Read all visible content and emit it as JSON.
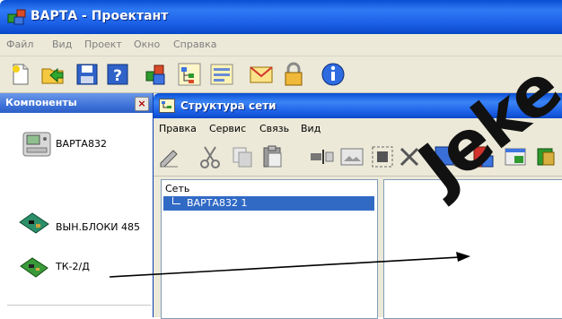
{
  "app": {
    "title": "ВАРТА - Проектант"
  },
  "menu": [
    "Файл",
    "Вид",
    "Проект",
    "Окно",
    "Справка"
  ],
  "toolbar": {
    "icons": [
      "new-icon",
      "open-icon",
      "save-icon",
      "help-icon",
      "components-icon",
      "tree-icon",
      "list-icon",
      "mail-icon",
      "lock-icon",
      "info-icon"
    ]
  },
  "components": {
    "header": "Компоненты",
    "close_glyph": "×",
    "items": [
      {
        "label": "ВАРТА832",
        "icon": "varta832-device-icon"
      },
      {
        "label": "ВЫН.БЛОКИ 485",
        "icon": "board-blocks-icon"
      },
      {
        "label": "ТК-2/Д",
        "icon": "board-tk-icon"
      }
    ]
  },
  "network_window": {
    "title": "Структура сети",
    "menu": [
      "Правка",
      "Сервис",
      "Связь",
      "Вид"
    ],
    "toolbar_icons": [
      "edit-icon",
      "cut-icon",
      "copy-icon",
      "paste-icon",
      "insert-icon",
      "image-icon",
      "split-icon",
      "delete-icon",
      "square-icon",
      "book-icon",
      "window-icon",
      "tools-icon"
    ],
    "tree": {
      "root": "Сеть",
      "item": "ВАРТА832 1"
    }
  },
  "watermark": "Jeke"
}
